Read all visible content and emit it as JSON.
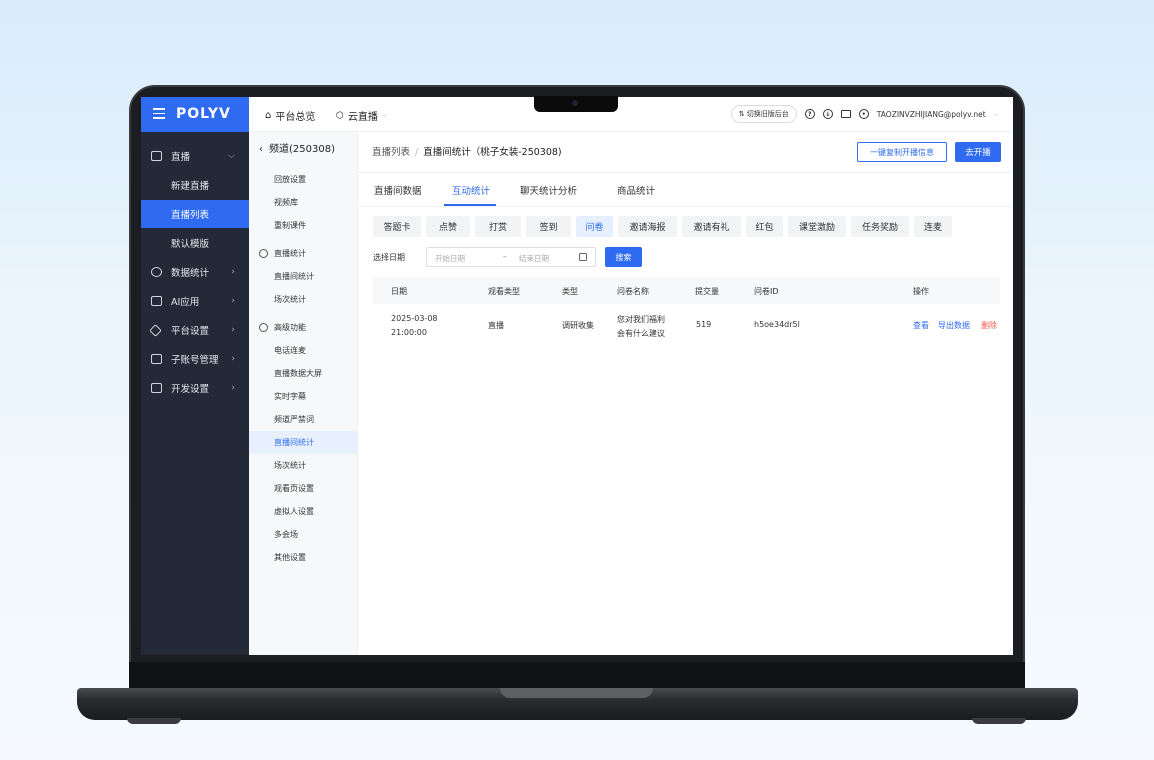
{
  "app": {
    "logo": "POLYV",
    "top_nav": [
      {
        "label": "平台总览"
      },
      {
        "label": "云直播"
      }
    ],
    "switch_old": "切换旧版后台",
    "user": "TAOZINVZHIJIANG@polyv.net"
  },
  "sidebar": {
    "items": [
      {
        "label": "直播",
        "icon": "video-icon"
      },
      {
        "label": "数据统计",
        "icon": "chart-icon"
      },
      {
        "label": "AI应用",
        "icon": "ai-icon"
      },
      {
        "label": "平台设置",
        "icon": "layers-icon"
      },
      {
        "label": "子账号管理",
        "icon": "account-icon"
      },
      {
        "label": "开发设置",
        "icon": "code-icon"
      }
    ],
    "live_sub": [
      {
        "label": "新建直播"
      },
      {
        "label": "直播列表"
      },
      {
        "label": "默认模版"
      }
    ]
  },
  "subside": {
    "channel": "频道(250308)",
    "items_top": [
      "回放设置",
      "视频库",
      "重制课件"
    ],
    "group_stats": "直播统计",
    "items_stats": [
      "直播间统计",
      "场次统计"
    ],
    "group_adv": "高级功能",
    "items_adv": [
      "电话连麦",
      "直播数据大屏",
      "实时字幕",
      "频道严禁词",
      "直播间统计",
      "场次统计",
      "观看页设置",
      "虚拟人设置",
      "多会场",
      "其他设置"
    ]
  },
  "main": {
    "breadcrumb_root": "直播列表",
    "breadcrumb_current": "直播间统计（桃子女装-250308)",
    "btn_copy": "一键复制开播信息",
    "btn_start": "去开播",
    "tabs": [
      "直播间数据",
      "互动统计",
      "聊天统计分析",
      "商品统计"
    ],
    "chips": [
      "答题卡",
      "点赞",
      "打赏",
      "签到",
      "问卷",
      "邀请海报",
      "邀请有礼",
      "红包",
      "课堂激励",
      "任务奖励",
      "连麦"
    ],
    "date_label": "选择日期",
    "date_start_ph": "开始日期",
    "date_end_ph": "结束日期",
    "date_dash": "–",
    "btn_search": "搜索",
    "table": {
      "headers": [
        "日期",
        "观看类型",
        "类型",
        "问卷名称",
        "提交量",
        "问卷ID",
        "操作"
      ],
      "rows": [
        {
          "date": "2025-03-08",
          "time": "21:00:00",
          "watch_type": "直播",
          "type": "调研收集",
          "name_line1": "您对我们福利",
          "name_line2": "会有什么建议",
          "count": "519",
          "id": "h5oe34dr5l",
          "actions": [
            "查看",
            "导出数据",
            "删除"
          ]
        }
      ]
    }
  },
  "colors": {
    "brand": "#2e6bf0",
    "sidebar_bg": "#232937",
    "danger": "#f5564a"
  }
}
